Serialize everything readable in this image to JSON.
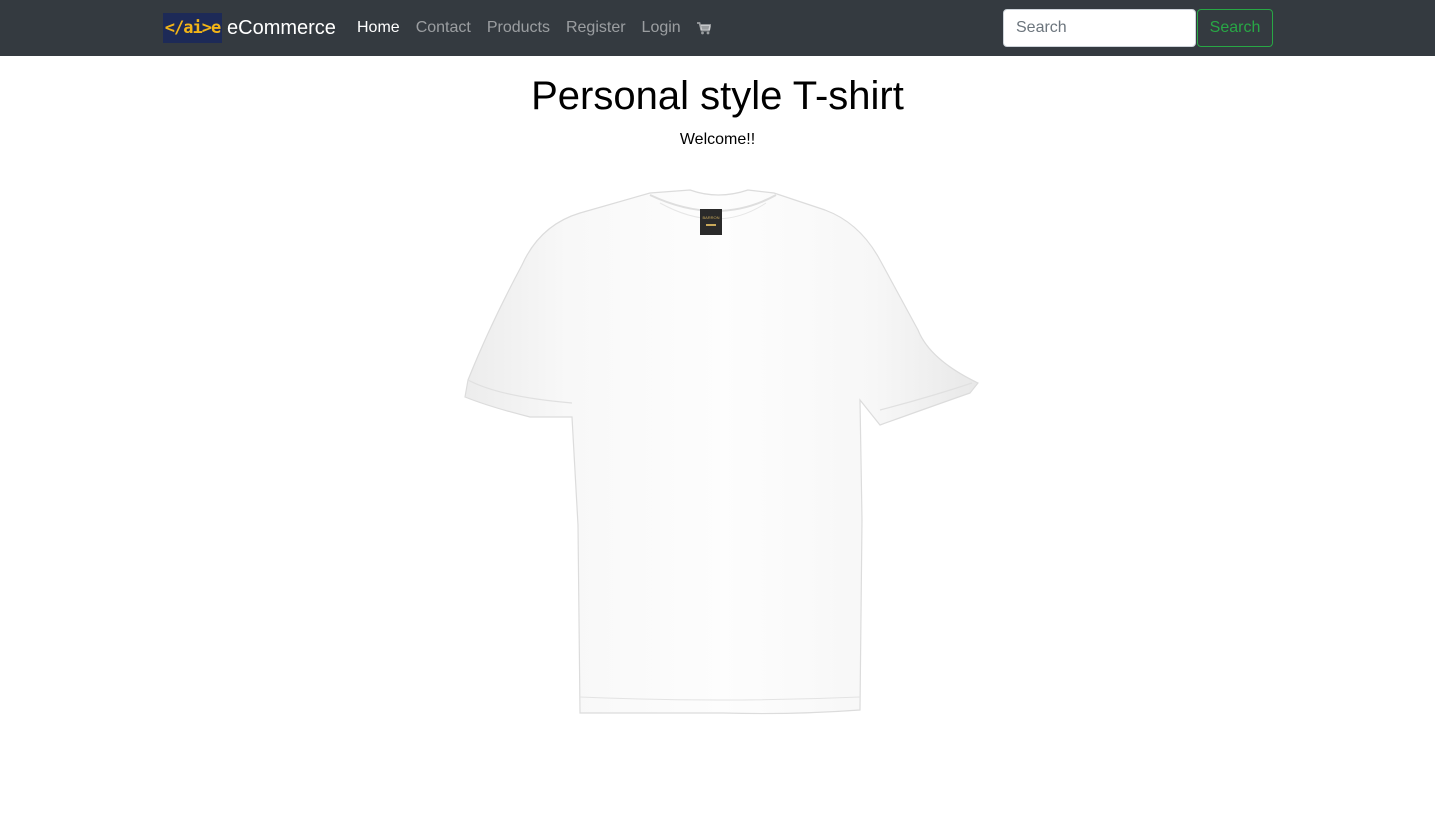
{
  "navbar": {
    "brand_logo_text": "</ai>e",
    "brand_name": "eCommerce",
    "links": [
      "Home",
      "Contact",
      "Products",
      "Register",
      "Login"
    ],
    "active_link": "Home",
    "cart_icon": "shopping-cart-icon"
  },
  "search": {
    "placeholder": "Search",
    "value": "",
    "button_label": "Search"
  },
  "main": {
    "title": "Personal style T-shirt",
    "welcome_text": "Welcome!!",
    "product_image_label": "BARRON"
  },
  "colors": {
    "navbar_bg": "#343a40",
    "search_button": "#28a745",
    "logo_bg": "#1d2a57",
    "logo_accent": "#f2b418"
  }
}
